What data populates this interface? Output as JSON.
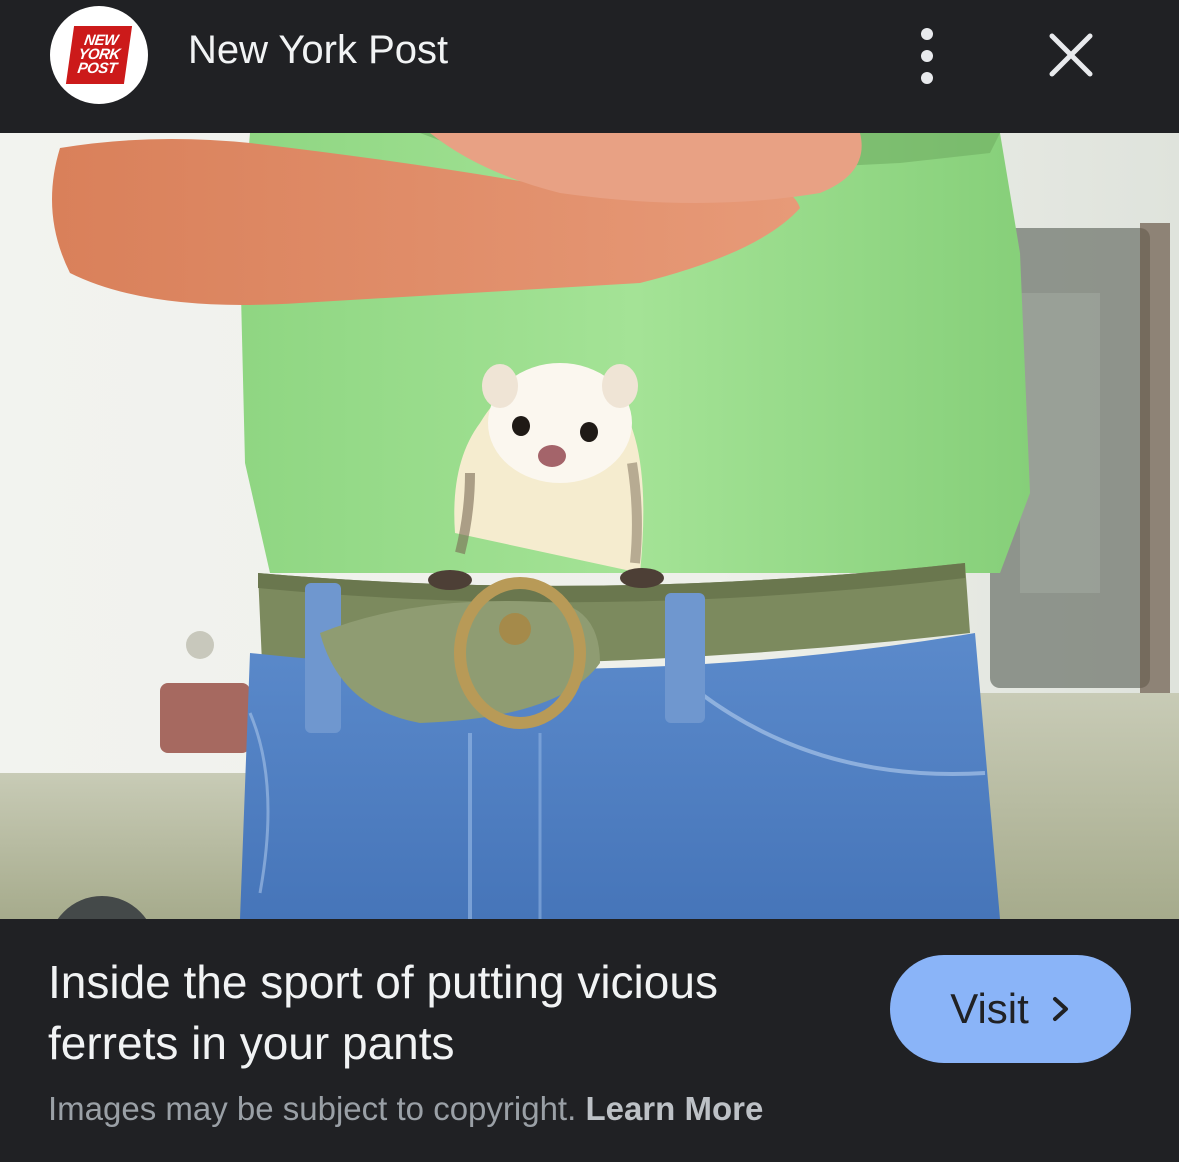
{
  "header": {
    "logo_lines": [
      "NEW",
      "YORK",
      "POST"
    ],
    "source_title": "New York Post"
  },
  "image": {
    "description_icon": "lens-icon"
  },
  "result": {
    "title": "Inside the sport of putting vicious ferrets in your pants",
    "visit_label": "Visit",
    "copyright_text": "Images may be subject to copyright.",
    "learn_more": "Learn More"
  },
  "colors": {
    "background": "#202124",
    "visit_button": "#8ab4f8",
    "logo_red": "#cc1a1a",
    "shirt_green": "#9bdc8c",
    "jeans_blue": "#4f80c4"
  }
}
